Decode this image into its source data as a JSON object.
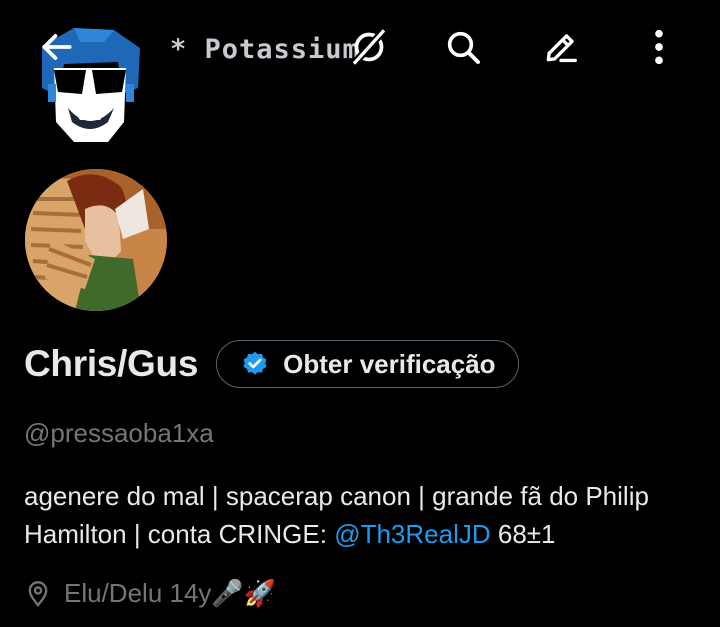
{
  "header": {
    "banner_text": "* Potassium",
    "back_icon": "arrow-left-icon",
    "hide_icon": "eye-slash-icon",
    "search_icon": "search-icon",
    "edit_icon": "pencil-icon",
    "more_icon": "more-vertical-icon"
  },
  "profile": {
    "display_name": "Chris/Gus",
    "verify_label": "Obter verificação",
    "handle": "@pressaoba1xa",
    "bio_text": "agenere do mal | spacerap canon | grande fã do Philip Hamilton | conta CRINGE: ",
    "bio_mention": "@Th3RealJD",
    "bio_suffix": " 68±1",
    "location": "Elu/Delu 14y🎤🚀"
  },
  "colors": {
    "background": "#000000",
    "text": "#e7e9ea",
    "muted": "#71767b",
    "accent": "#1d9bf0"
  }
}
